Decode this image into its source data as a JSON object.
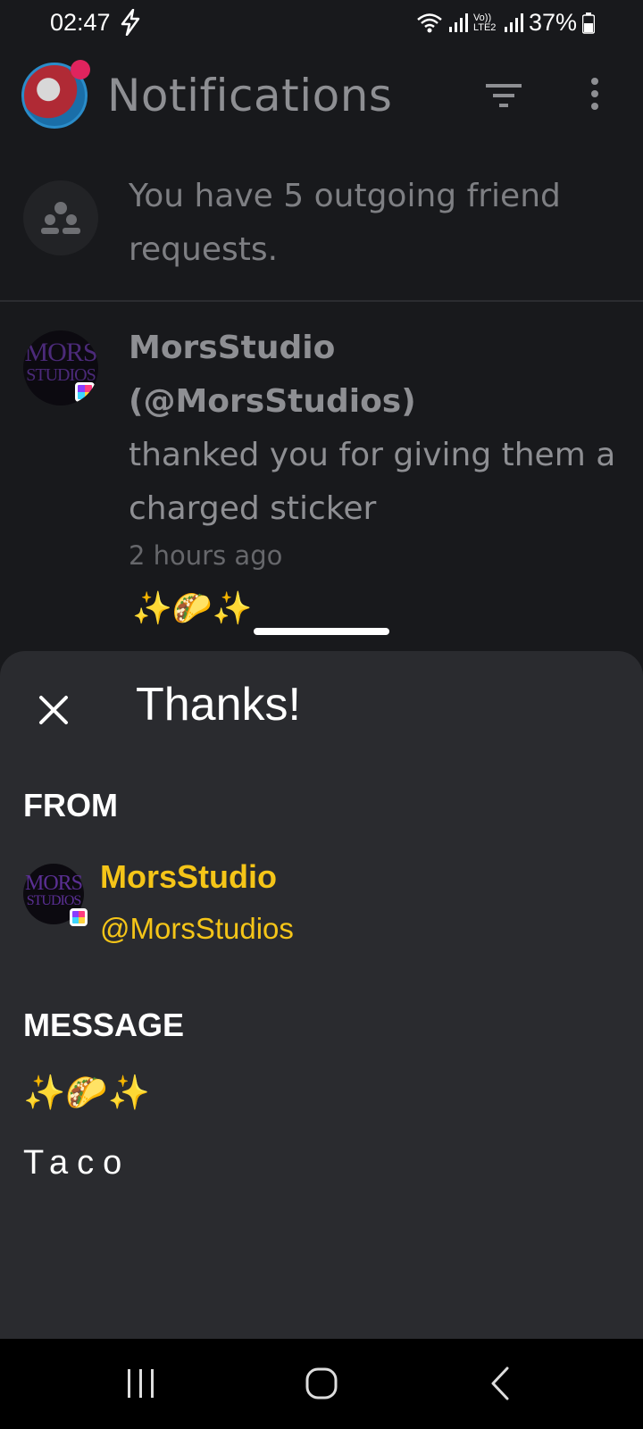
{
  "status_bar": {
    "time": "02:47",
    "network_label": "Vo)) LTE2",
    "battery": "37%"
  },
  "header": {
    "title": "Notifications",
    "icons": [
      "filter-icon",
      "more-vert-icon"
    ]
  },
  "notifications": [
    {
      "type": "friend_requests",
      "text": "You have 5 outgoing friend requests."
    },
    {
      "type": "thanks",
      "name": "MorsStudio",
      "handle": "(@MorsStudios)",
      "body": "thanked you for giving them a charged sticker",
      "time": "2 hours ago",
      "emoji": "✨🌮✨",
      "avatar_text": [
        "MORS",
        "STUDIOS"
      ]
    }
  ],
  "sheet": {
    "title": "Thanks!",
    "from_label": "FROM",
    "from_name": "MorsStudio",
    "from_handle": "@MorsStudios",
    "message_label": "MESSAGE",
    "message_emoji": "✨🌮✨",
    "message_text": "Taco"
  },
  "colors": {
    "background": "#18191c",
    "sheet": "#2a2b2f",
    "accent": "#f5c518"
  }
}
